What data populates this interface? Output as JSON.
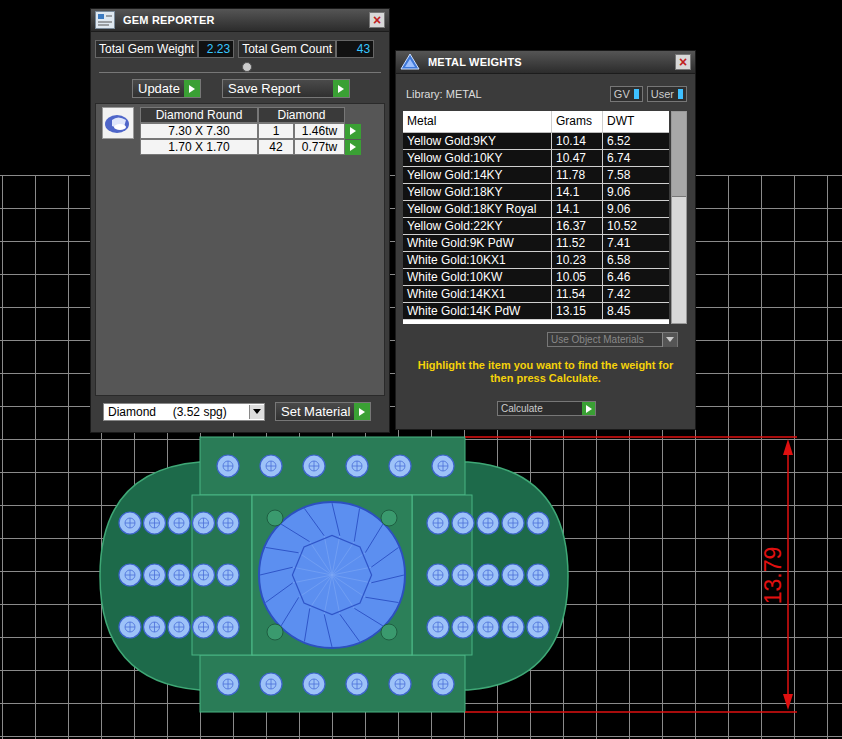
{
  "gem_reporter": {
    "title": "GEM REPORTER",
    "close": "×",
    "total_weight_label": "Total Gem Weight",
    "total_weight": "2.23",
    "total_count_label": "Total Gem Count",
    "total_count": "43",
    "buttons": [
      {
        "label": "Update"
      },
      {
        "label": "Save Report"
      }
    ],
    "columns": [
      "Diamond Round",
      "Diamond"
    ],
    "rows": [
      {
        "size": "7.30 X 7.30",
        "count": "1",
        "weight": "1.46tw"
      },
      {
        "size": "1.70 X 1.70",
        "count": "42",
        "weight": "0.77tw"
      }
    ],
    "material_select": "Diamond     (3.52 spg)",
    "set_material": "Set Material"
  },
  "metal_weights": {
    "title": "METAL WEIGHTS",
    "close": "×",
    "library": "Library: METAL",
    "toggles": [
      {
        "label": "GV",
        "on": true
      },
      {
        "label": "User",
        "on": true
      }
    ],
    "columns": [
      "Metal",
      "Grams",
      "DWT"
    ],
    "rows": [
      {
        "metal": "Yellow Gold:9KY",
        "grams": "10.14",
        "dwt": "6.52"
      },
      {
        "metal": "Yellow Gold:10KY",
        "grams": "10.47",
        "dwt": "6.74"
      },
      {
        "metal": "Yellow Gold:14KY",
        "grams": "11.78",
        "dwt": "7.58"
      },
      {
        "metal": "Yellow Gold:18KY",
        "grams": "14.1",
        "dwt": "9.06"
      },
      {
        "metal": "Yellow Gold:18KY Royal",
        "grams": "14.1",
        "dwt": "9.06"
      },
      {
        "metal": "Yellow Gold:22KY",
        "grams": "16.37",
        "dwt": "10.52"
      },
      {
        "metal": "White Gold:9K PdW",
        "grams": "11.52",
        "dwt": "7.41"
      },
      {
        "metal": "White Gold:10KX1",
        "grams": "10.23",
        "dwt": "6.58"
      },
      {
        "metal": "White Gold:10KW",
        "grams": "10.05",
        "dwt": "6.46"
      },
      {
        "metal": "White Gold:14KX1",
        "grams": "11.54",
        "dwt": "7.42"
      },
      {
        "metal": "White Gold:14K PdW",
        "grams": "13.15",
        "dwt": "8.45"
      }
    ],
    "scrollbar": {
      "level": 0.4
    },
    "use_object_materials": "Use Object Materials",
    "hint": "Highlight the item you want to find the weight for then press Calculate.",
    "calculate": "Calculate"
  },
  "viewport": {
    "dimension": "13.79"
  }
}
